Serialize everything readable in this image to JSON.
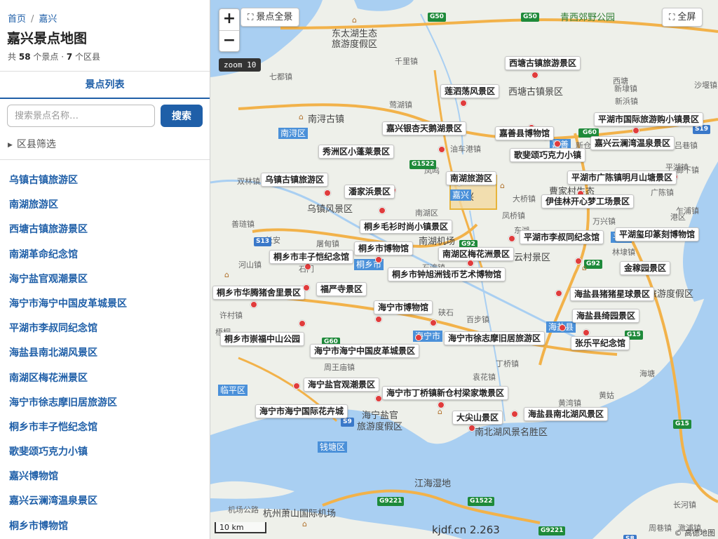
{
  "breadcrumb": {
    "home": "首页",
    "current": "嘉兴"
  },
  "page_title": "嘉兴景点地图",
  "stats": {
    "prefix": "共",
    "spots": "58",
    "spots_unit": "个景点 ·",
    "districts": "7",
    "districts_unit": "个区县"
  },
  "tab_label": "景点列表",
  "search": {
    "placeholder": "搜索景点名称…",
    "button": "搜索"
  },
  "filter_label": "区县筛选",
  "spot_list": [
    "乌镇古镇旅游区",
    "南湖旅游区",
    "西塘古镇旅游景区",
    "南湖革命纪念馆",
    "海宁盐官观潮景区",
    "海宁市海宁中国皮革城景区",
    "平湖市李叔同纪念馆",
    "海盐县南北湖风景区",
    "南湖区梅花洲景区",
    "海宁市徐志摩旧居旅游区",
    "桐乡市丰子恺纪念馆",
    "歌斐颂巧克力小镇",
    "嘉兴博物馆",
    "嘉兴云澜湾温泉景区",
    "桐乡市博物馆"
  ],
  "map": {
    "zoom_in": "+",
    "zoom_out": "−",
    "overview_button": "景点全景",
    "fullscreen_button": "全屏",
    "zoom_badge": "zoom 10",
    "scale": "10 km",
    "watermark": "kjdf.cn 2.263",
    "copyright": "© 高德地图",
    "colors": {
      "marker": "#e03c3c",
      "water": "#a9cff2",
      "district_tag": "#4a90d9",
      "accent": "#1f5fa8"
    },
    "marker_labels": [
      "西塘古镇旅游景区",
      "莲泗荡风景区",
      "平湖市国际旅游购小镇景区",
      "嘉兴银杏天鹅湖景区",
      "嘉善县博物馆",
      "嘉兴云澜湾温泉景区",
      "秀洲区小蓬莱景区",
      "歌斐颂巧克力小镇",
      "乌镇古镇旅游区",
      "南湖旅游区",
      "平湖市广陈镇明月山塘景区",
      "潘家浜景区",
      "伊佳林开心梦工场景区",
      "桐乡毛衫时尚小镇景区",
      "平湖市李叔同纪念馆",
      "平湖玺印篆刻博物馆",
      "桐乡市丰子恺纪念馆",
      "桐乡市博物馆",
      "南湖区梅花洲景区",
      "桐乡市钟旭洲钱币艺术博物馆",
      "金稼园景区",
      "桐乡市华腾猪舍里景区",
      "福严寺景区",
      "海盐县猪猪星球景区",
      "海宁市博物馆",
      "海盐县绮园景区",
      "桐乡市崇福中山公园",
      "海宁市徐志摩旧居旅游区",
      "张乐平纪念馆",
      "海宁市海宁中国皮革城景区",
      "海宁盐官观潮景区",
      "海宁市丁桥镇新仓村梁家墩景区",
      "海宁市海宁国际花卉城",
      "大尖山景区",
      "海盐县南北湖风景区"
    ],
    "place_labels": [
      "东太湖生态",
      "旅游度假区",
      "千里镇",
      "七都镇",
      "南浔古镇",
      "青西郊野公园",
      "西塘古镇景区",
      "新埭镇",
      "吕巷镇",
      "油车港镇",
      "双林镇",
      "乌镇风景区",
      "善琏镇",
      "河山镇",
      "石门",
      "大桥镇",
      "曹家村生态",
      "广陈镇",
      "廊下镇",
      "新仓镇",
      "林埭镇",
      "凤桥镇",
      "南湖机场",
      "南湖区",
      "嘉兴",
      "云村景区",
      "梧桐",
      "百步镇",
      "周王庙镇",
      "袁花镇",
      "海宁盐官",
      "旅游度假区",
      "南北湖风景名胜区",
      "江海湿地",
      "机场公路",
      "杭州萧山国际机场",
      "澉浦镇",
      "旅游度假区",
      "长河镇",
      "周巷镇",
      "新浜镇",
      "沙堰镇",
      "乌镇",
      "长安",
      "屠甸镇",
      "许村镇",
      "大麻",
      "石湾镇",
      "凤鸣",
      "莺湖镇",
      "西塘",
      "平湖镇",
      "乍浦镇",
      "黄湾镇",
      "丁桥镇",
      "硖石",
      "东湖",
      "万兴镇",
      "港区",
      "海塘",
      "黄姑",
      "新浦"
    ],
    "district_tags": [
      "南浔区",
      "嘉兴",
      "桐乡市",
      "海宁市",
      "临平区",
      "钱塘区",
      "海盐县",
      "嘉善",
      "平湖"
    ],
    "road_shields": [
      "G50",
      "G50",
      "G60",
      "G1522",
      "S13",
      "S19",
      "G92",
      "G60",
      "G92",
      "G15",
      "G1522",
      "S9",
      "G15",
      "G9221",
      "G9221",
      "S8",
      "G60"
    ]
  }
}
